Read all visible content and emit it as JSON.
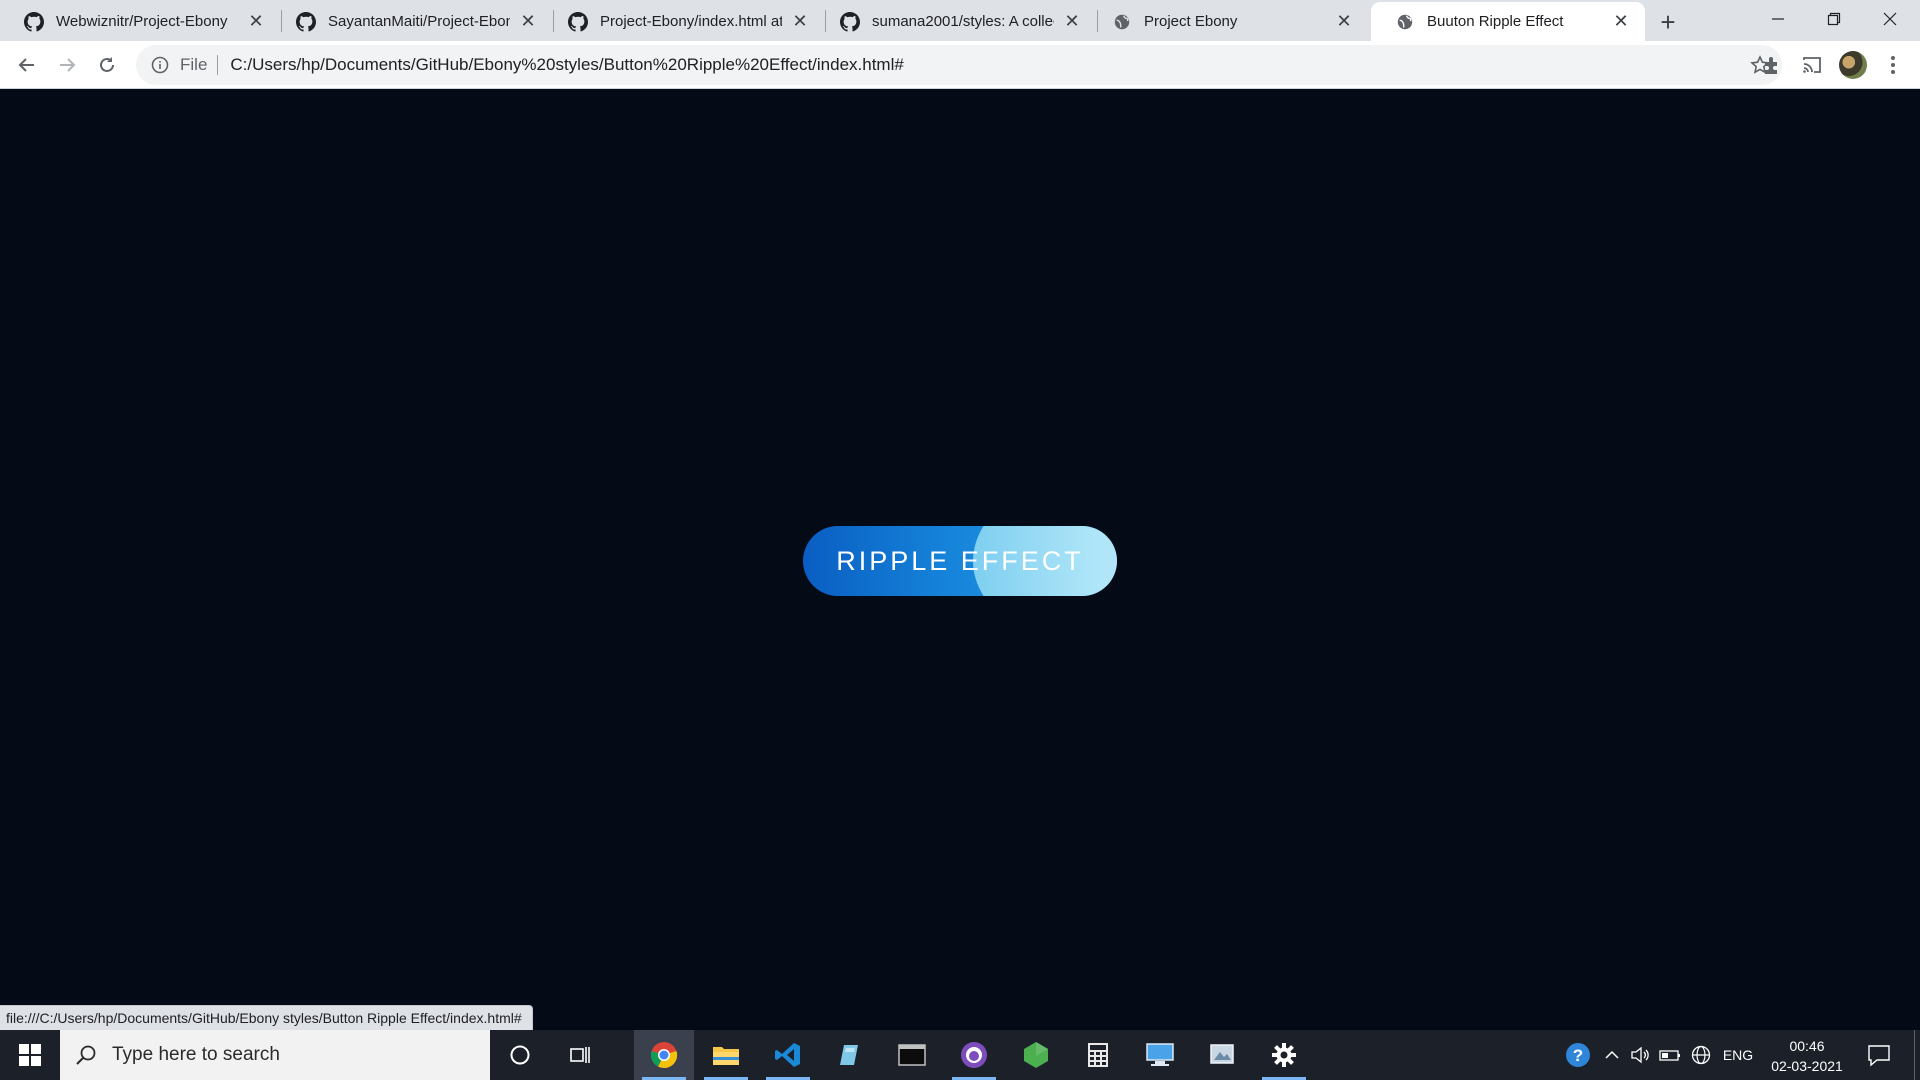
{
  "browser": {
    "tabs": [
      {
        "title": "Webwiznitr/Project-Ebony",
        "icon": "github-icon",
        "active": false
      },
      {
        "title": "SayantanMaiti/Project-Ebony",
        "icon": "github-icon",
        "active": false
      },
      {
        "title": "Project-Ebony/index.html at",
        "icon": "github-icon",
        "active": false
      },
      {
        "title": "sumana2001/styles: A collect",
        "icon": "github-icon",
        "active": false
      },
      {
        "title": "Project Ebony",
        "icon": "globe-icon",
        "active": false
      },
      {
        "title": "Buuton Ripple Effect",
        "icon": "globe-icon",
        "active": true
      }
    ],
    "address": {
      "scheme_label": "File",
      "url": "C:/Users/hp/Documents/GitHub/Ebony%20styles/Button%20Ripple%20Effect/index.html#"
    },
    "status_url": "file:///C:/Users/hp/Documents/GitHub/Ebony styles/Button Ripple Effect/index.html#"
  },
  "page": {
    "button_label": "RIPPLE EFFECT",
    "background_color": "#040a16",
    "button_gradient": [
      "#0a5dc2",
      "#2c9de6"
    ],
    "ripple_color": "#aee5f8"
  },
  "taskbar": {
    "search_placeholder": "Type here to search",
    "apps": [
      "chrome-icon",
      "file-explorer-icon",
      "vscode-icon",
      "notepad-icon",
      "terminal-icon",
      "github-desktop-icon",
      "nodejs-icon",
      "calculator-icon",
      "remote-desktop-icon",
      "snipping-tool-icon",
      "settings-icon"
    ],
    "language": "ENG",
    "time": "00:46",
    "date": "02-03-2021"
  }
}
